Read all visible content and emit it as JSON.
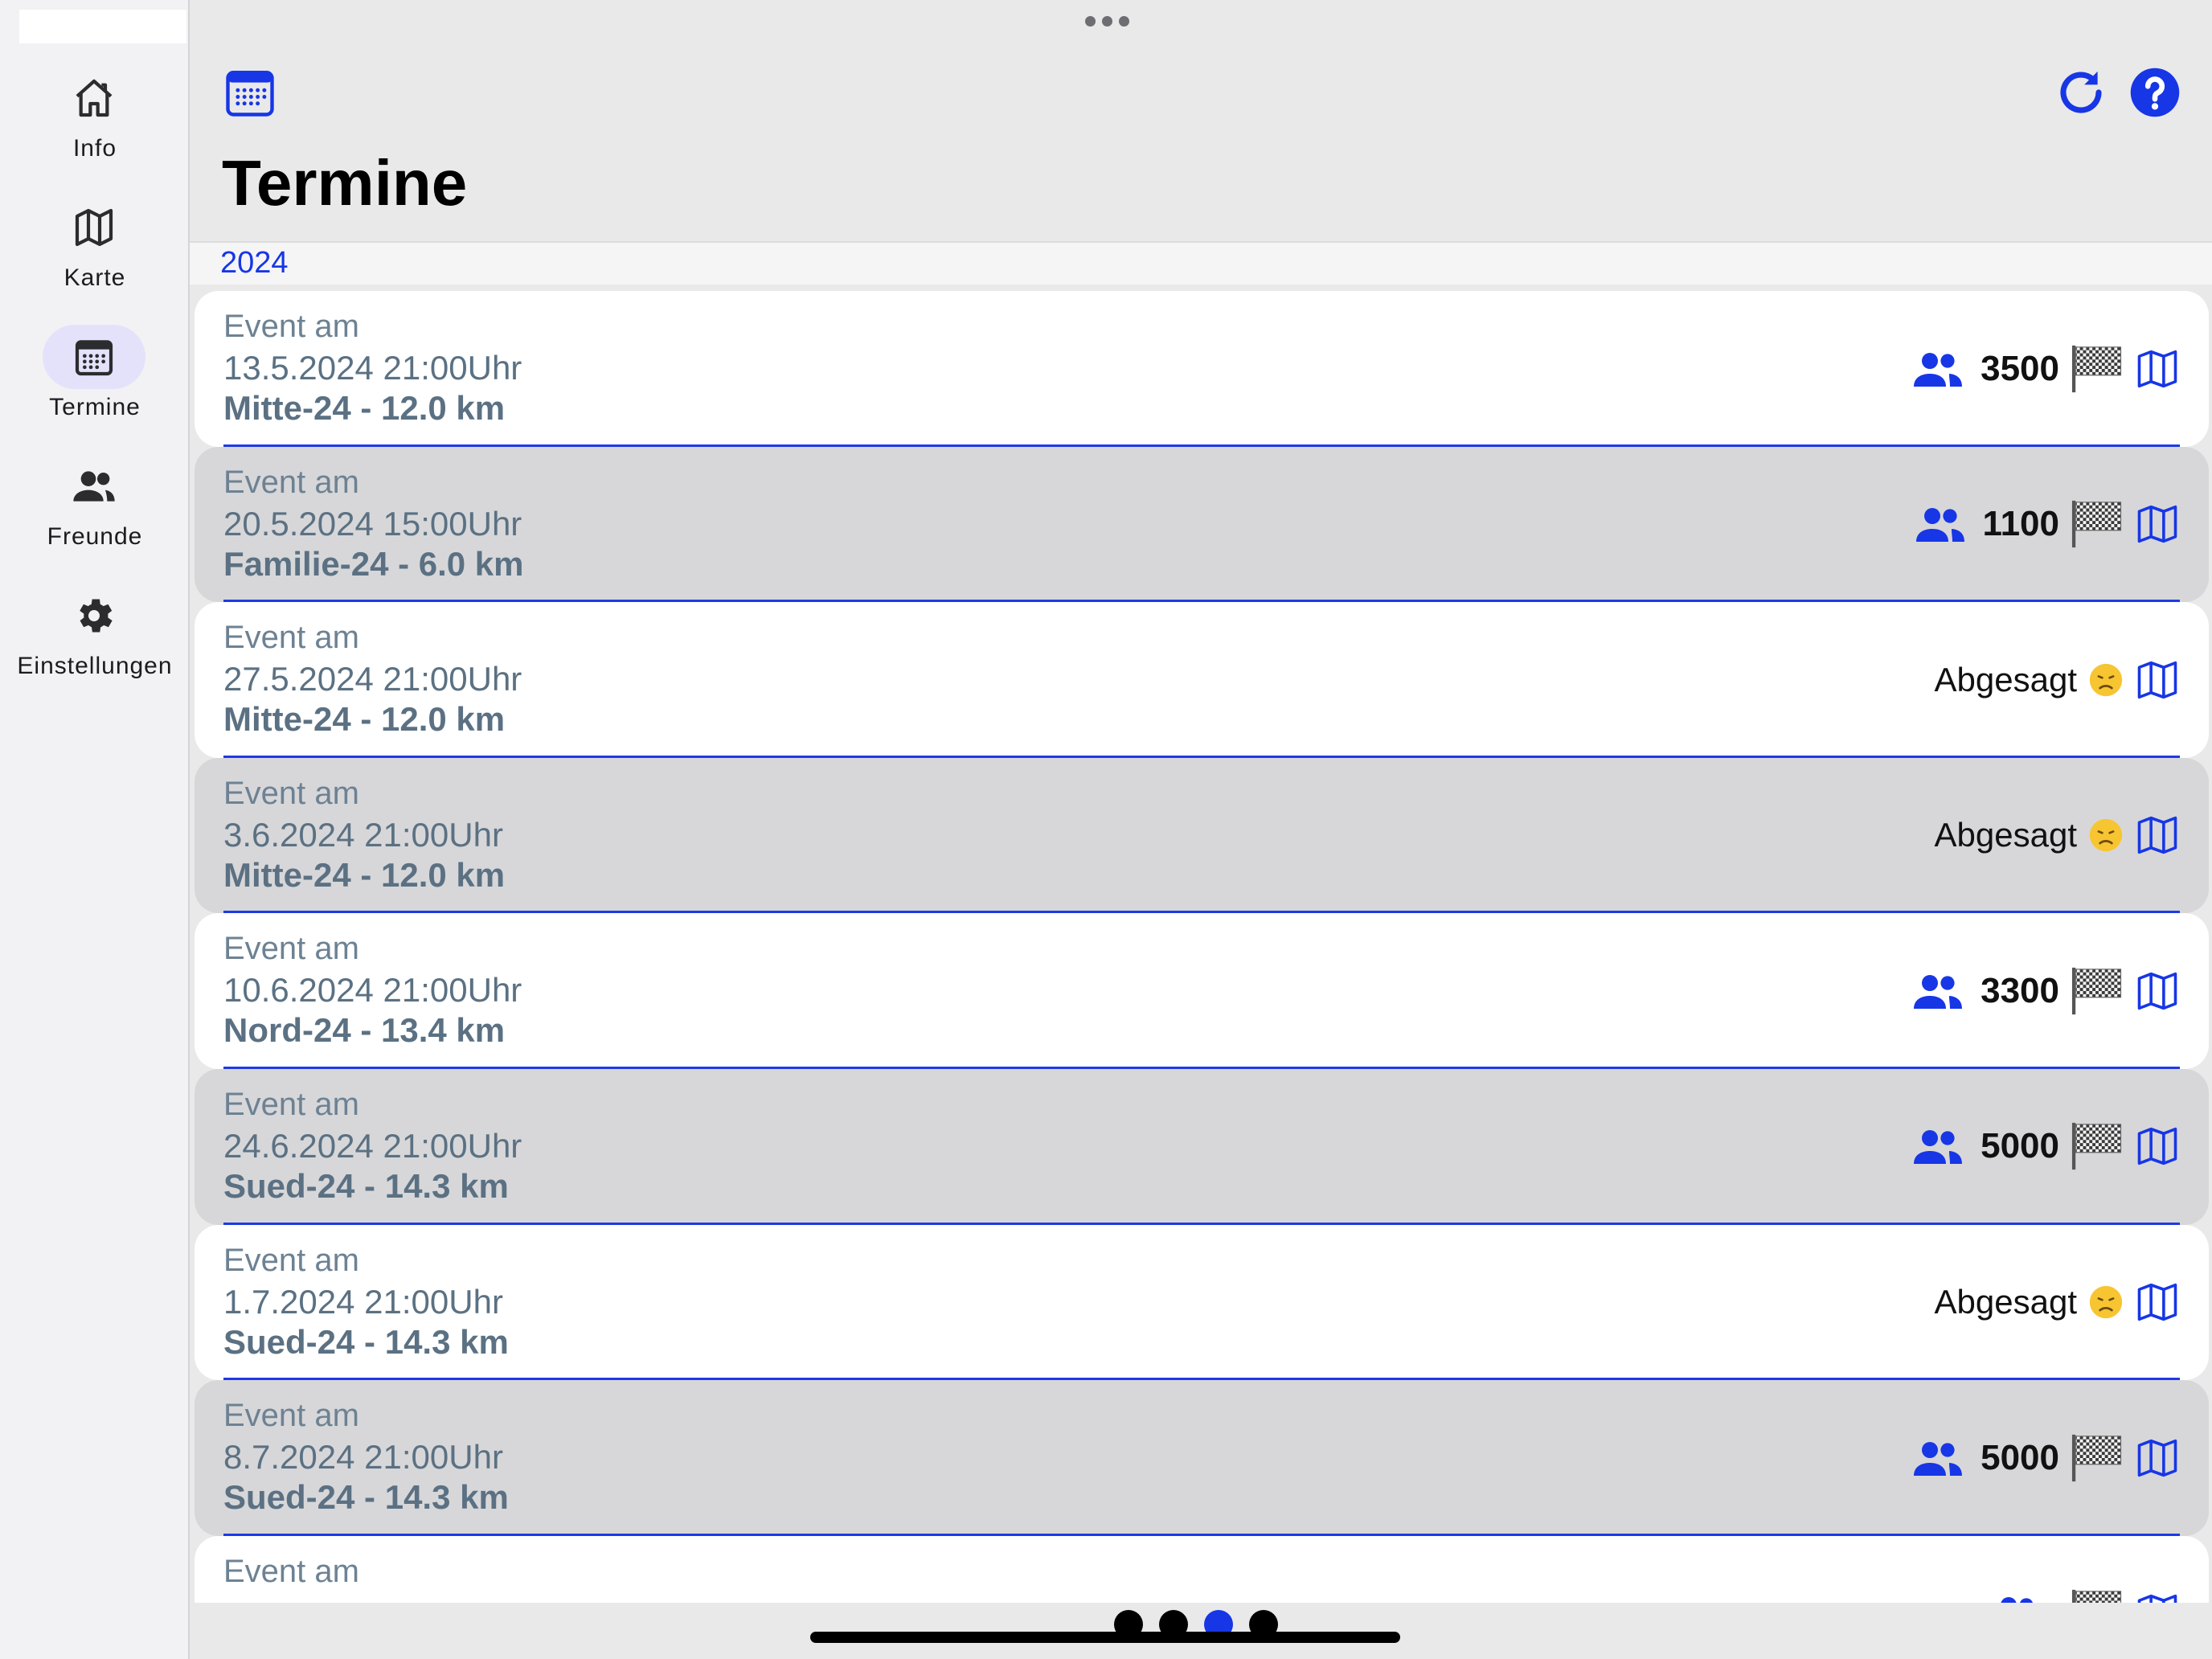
{
  "sidebar": {
    "items": [
      {
        "label": "Info",
        "icon": "house-icon",
        "active": false
      },
      {
        "label": "Karte",
        "icon": "map-icon",
        "active": false
      },
      {
        "label": "Termine",
        "icon": "calendar-icon",
        "active": true
      },
      {
        "label": "Freunde",
        "icon": "people-icon",
        "active": false
      },
      {
        "label": "Einstellungen",
        "icon": "gear-icon",
        "active": false
      }
    ]
  },
  "header": {
    "title": "Termine",
    "year": "2024",
    "left_icon": "calendar-icon",
    "right_icons": [
      "refresh-icon",
      "help-icon"
    ]
  },
  "colors": {
    "accent": "#1736e6",
    "row_light": "#ffffff",
    "row_dark": "#d7d7d9",
    "text_muted": "#5b7183"
  },
  "events": [
    {
      "prefix": "Event am",
      "datetime": "13.5.2024 21:00Uhr",
      "route": "Mitte-24 - 12.0 km",
      "count": "3500",
      "status": null
    },
    {
      "prefix": "Event am",
      "datetime": "20.5.2024 15:00Uhr",
      "route": "Familie-24 - 6.0 km",
      "count": "1100",
      "status": null
    },
    {
      "prefix": "Event am",
      "datetime": "27.5.2024 21:00Uhr",
      "route": "Mitte-24 - 12.0 km",
      "count": null,
      "status": "Abgesagt"
    },
    {
      "prefix": "Event am",
      "datetime": "3.6.2024 21:00Uhr",
      "route": "Mitte-24 - 12.0 km",
      "count": null,
      "status": "Abgesagt"
    },
    {
      "prefix": "Event am",
      "datetime": "10.6.2024 21:00Uhr",
      "route": "Nord-24 - 13.4 km",
      "count": "3300",
      "status": null
    },
    {
      "prefix": "Event am",
      "datetime": "24.6.2024 21:00Uhr",
      "route": "Sued-24 - 14.3 km",
      "count": "5000",
      "status": null
    },
    {
      "prefix": "Event am",
      "datetime": "1.7.2024 21:00Uhr",
      "route": "Sued-24 - 14.3 km",
      "count": null,
      "status": "Abgesagt"
    },
    {
      "prefix": "Event am",
      "datetime": "8.7.2024 21:00Uhr",
      "route": "Sued-24 - 14.3 km",
      "count": "5000",
      "status": null
    },
    {
      "prefix": "Event am",
      "datetime": "",
      "route": "",
      "count": "",
      "status": null
    }
  ],
  "pager": {
    "pages": 4,
    "current": 3
  }
}
